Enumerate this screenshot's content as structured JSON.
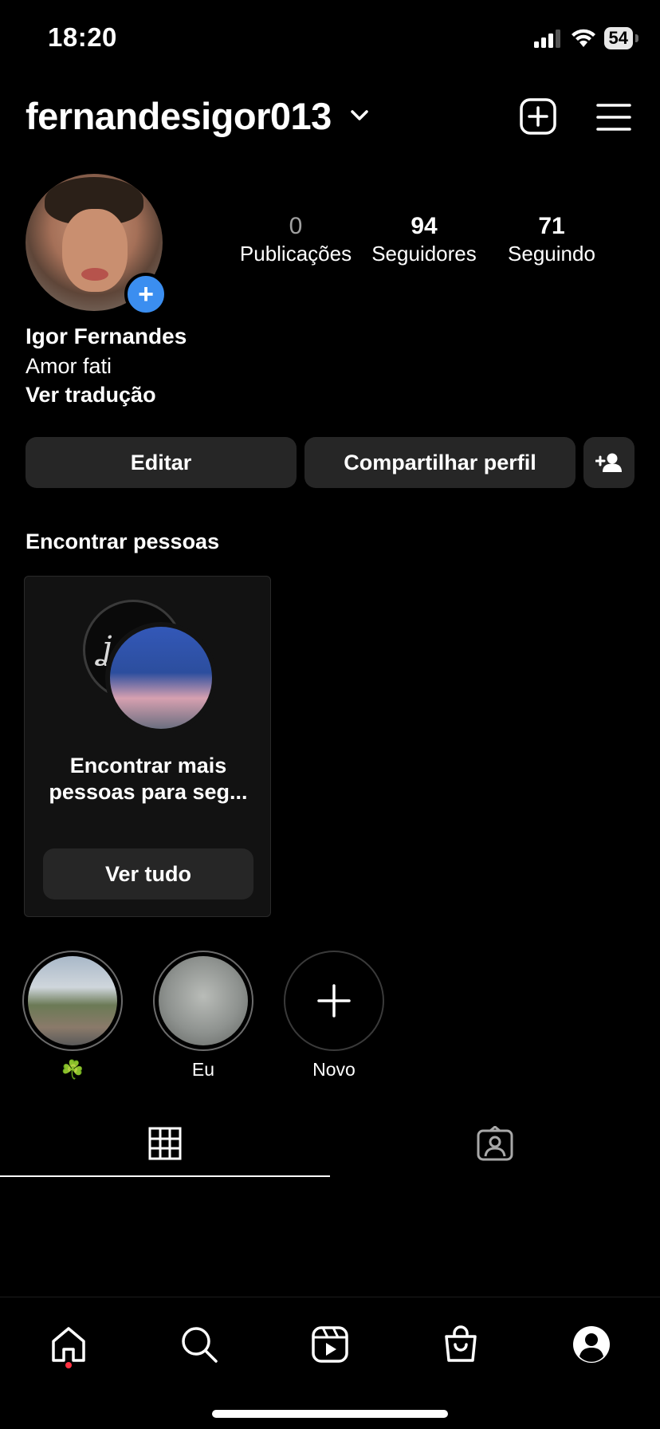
{
  "status": {
    "time": "18:20",
    "battery": "54"
  },
  "header": {
    "username": "fernandesigor013"
  },
  "stats": {
    "posts": {
      "value": "0",
      "label": "Publicações"
    },
    "followers": {
      "value": "94",
      "label": "Seguidores"
    },
    "following": {
      "value": "71",
      "label": "Seguindo"
    }
  },
  "profile": {
    "name": "Igor Fernandes",
    "bio": "Amor fati",
    "translate": "Ver tradução"
  },
  "buttons": {
    "edit": "Editar",
    "share": "Compartilhar perfil"
  },
  "discover": {
    "title": "Encontrar pessoas",
    "card_text_line1": "Encontrar mais",
    "card_text_line2": "pessoas para seg...",
    "see_all": "Ver tudo"
  },
  "highlights": [
    {
      "label": "☘️"
    },
    {
      "label": "Eu"
    },
    {
      "label": "Novo"
    }
  ],
  "colors": {
    "accent": "#3b8ef0",
    "background": "#000000",
    "button": "#262626",
    "notification": "#ff3040"
  }
}
